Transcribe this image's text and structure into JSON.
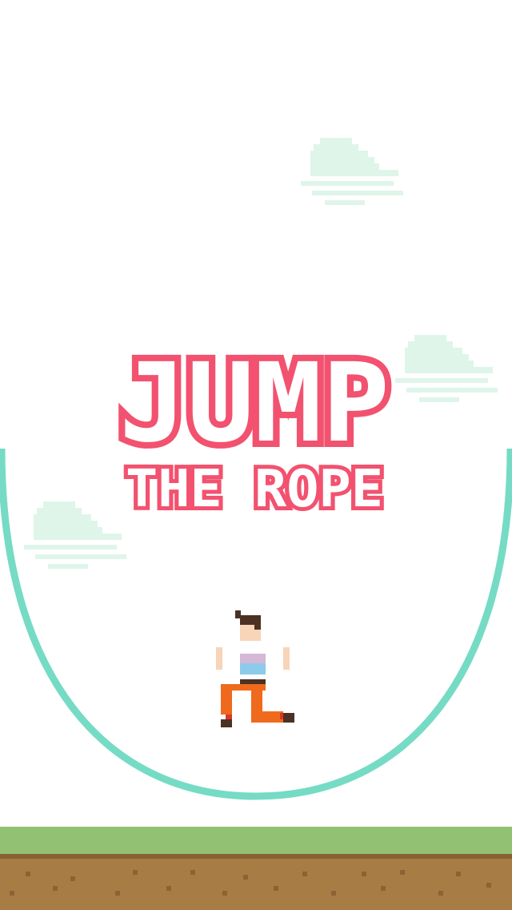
{
  "title": {
    "main": "JUMP",
    "sub": "THE ROPE"
  },
  "colors": {
    "title_fill": "#ffffff",
    "title_outline": "#f2526f",
    "rope": "#76dbc4",
    "cloud": "#dff5ea",
    "grass": "#93c173",
    "ground_edge": "#8a6033",
    "dirt": "#a87d45",
    "dirt_speck": "#8d6234",
    "skin": "#f8d4b8",
    "hair": "#4b3225",
    "shirt": "#ffffff",
    "stripe_top": "#d5b7d6",
    "stripe_bottom": "#8ccbeb",
    "belt": "#4b3225",
    "pants": "#ef6a1c",
    "shoe": "#4b3225",
    "sock": "#d8382c"
  },
  "scene": {
    "character": "player-character",
    "rope_icon": "rope-arc",
    "clouds": [
      "cloud-icon",
      "cloud-icon",
      "cloud-icon"
    ]
  }
}
